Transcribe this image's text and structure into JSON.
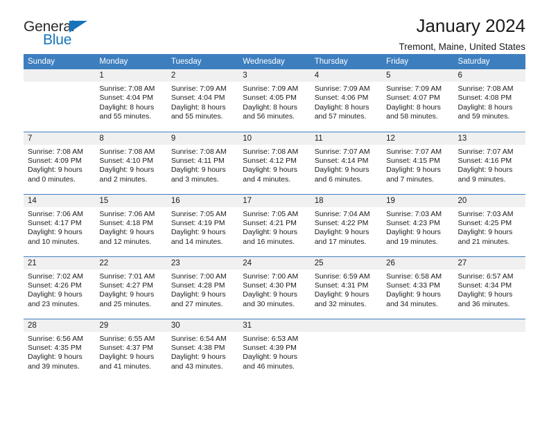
{
  "brand": {
    "name_top": "General",
    "name_bottom": "Blue",
    "accent_color": "#1574bb"
  },
  "header": {
    "title": "January 2024",
    "subtitle": "Tremont, Maine, United States"
  },
  "theme": {
    "header_row_bg": "#3d7ebf",
    "daynum_bg": "#f0f0f0",
    "text_color": "#1a1a1a"
  },
  "weekday_headers": [
    "Sunday",
    "Monday",
    "Tuesday",
    "Wednesday",
    "Thursday",
    "Friday",
    "Saturday"
  ],
  "weeks": [
    [
      {
        "day": "",
        "sunrise": "",
        "sunset": "",
        "daylight_line1": "",
        "daylight_line2": ""
      },
      {
        "day": "1",
        "sunrise": "Sunrise: 7:08 AM",
        "sunset": "Sunset: 4:04 PM",
        "daylight_line1": "Daylight: 8 hours",
        "daylight_line2": "and 55 minutes."
      },
      {
        "day": "2",
        "sunrise": "Sunrise: 7:09 AM",
        "sunset": "Sunset: 4:04 PM",
        "daylight_line1": "Daylight: 8 hours",
        "daylight_line2": "and 55 minutes."
      },
      {
        "day": "3",
        "sunrise": "Sunrise: 7:09 AM",
        "sunset": "Sunset: 4:05 PM",
        "daylight_line1": "Daylight: 8 hours",
        "daylight_line2": "and 56 minutes."
      },
      {
        "day": "4",
        "sunrise": "Sunrise: 7:09 AM",
        "sunset": "Sunset: 4:06 PM",
        "daylight_line1": "Daylight: 8 hours",
        "daylight_line2": "and 57 minutes."
      },
      {
        "day": "5",
        "sunrise": "Sunrise: 7:09 AM",
        "sunset": "Sunset: 4:07 PM",
        "daylight_line1": "Daylight: 8 hours",
        "daylight_line2": "and 58 minutes."
      },
      {
        "day": "6",
        "sunrise": "Sunrise: 7:08 AM",
        "sunset": "Sunset: 4:08 PM",
        "daylight_line1": "Daylight: 8 hours",
        "daylight_line2": "and 59 minutes."
      }
    ],
    [
      {
        "day": "7",
        "sunrise": "Sunrise: 7:08 AM",
        "sunset": "Sunset: 4:09 PM",
        "daylight_line1": "Daylight: 9 hours",
        "daylight_line2": "and 0 minutes."
      },
      {
        "day": "8",
        "sunrise": "Sunrise: 7:08 AM",
        "sunset": "Sunset: 4:10 PM",
        "daylight_line1": "Daylight: 9 hours",
        "daylight_line2": "and 2 minutes."
      },
      {
        "day": "9",
        "sunrise": "Sunrise: 7:08 AM",
        "sunset": "Sunset: 4:11 PM",
        "daylight_line1": "Daylight: 9 hours",
        "daylight_line2": "and 3 minutes."
      },
      {
        "day": "10",
        "sunrise": "Sunrise: 7:08 AM",
        "sunset": "Sunset: 4:12 PM",
        "daylight_line1": "Daylight: 9 hours",
        "daylight_line2": "and 4 minutes."
      },
      {
        "day": "11",
        "sunrise": "Sunrise: 7:07 AM",
        "sunset": "Sunset: 4:14 PM",
        "daylight_line1": "Daylight: 9 hours",
        "daylight_line2": "and 6 minutes."
      },
      {
        "day": "12",
        "sunrise": "Sunrise: 7:07 AM",
        "sunset": "Sunset: 4:15 PM",
        "daylight_line1": "Daylight: 9 hours",
        "daylight_line2": "and 7 minutes."
      },
      {
        "day": "13",
        "sunrise": "Sunrise: 7:07 AM",
        "sunset": "Sunset: 4:16 PM",
        "daylight_line1": "Daylight: 9 hours",
        "daylight_line2": "and 9 minutes."
      }
    ],
    [
      {
        "day": "14",
        "sunrise": "Sunrise: 7:06 AM",
        "sunset": "Sunset: 4:17 PM",
        "daylight_line1": "Daylight: 9 hours",
        "daylight_line2": "and 10 minutes."
      },
      {
        "day": "15",
        "sunrise": "Sunrise: 7:06 AM",
        "sunset": "Sunset: 4:18 PM",
        "daylight_line1": "Daylight: 9 hours",
        "daylight_line2": "and 12 minutes."
      },
      {
        "day": "16",
        "sunrise": "Sunrise: 7:05 AM",
        "sunset": "Sunset: 4:19 PM",
        "daylight_line1": "Daylight: 9 hours",
        "daylight_line2": "and 14 minutes."
      },
      {
        "day": "17",
        "sunrise": "Sunrise: 7:05 AM",
        "sunset": "Sunset: 4:21 PM",
        "daylight_line1": "Daylight: 9 hours",
        "daylight_line2": "and 16 minutes."
      },
      {
        "day": "18",
        "sunrise": "Sunrise: 7:04 AM",
        "sunset": "Sunset: 4:22 PM",
        "daylight_line1": "Daylight: 9 hours",
        "daylight_line2": "and 17 minutes."
      },
      {
        "day": "19",
        "sunrise": "Sunrise: 7:03 AM",
        "sunset": "Sunset: 4:23 PM",
        "daylight_line1": "Daylight: 9 hours",
        "daylight_line2": "and 19 minutes."
      },
      {
        "day": "20",
        "sunrise": "Sunrise: 7:03 AM",
        "sunset": "Sunset: 4:25 PM",
        "daylight_line1": "Daylight: 9 hours",
        "daylight_line2": "and 21 minutes."
      }
    ],
    [
      {
        "day": "21",
        "sunrise": "Sunrise: 7:02 AM",
        "sunset": "Sunset: 4:26 PM",
        "daylight_line1": "Daylight: 9 hours",
        "daylight_line2": "and 23 minutes."
      },
      {
        "day": "22",
        "sunrise": "Sunrise: 7:01 AM",
        "sunset": "Sunset: 4:27 PM",
        "daylight_line1": "Daylight: 9 hours",
        "daylight_line2": "and 25 minutes."
      },
      {
        "day": "23",
        "sunrise": "Sunrise: 7:00 AM",
        "sunset": "Sunset: 4:28 PM",
        "daylight_line1": "Daylight: 9 hours",
        "daylight_line2": "and 27 minutes."
      },
      {
        "day": "24",
        "sunrise": "Sunrise: 7:00 AM",
        "sunset": "Sunset: 4:30 PM",
        "daylight_line1": "Daylight: 9 hours",
        "daylight_line2": "and 30 minutes."
      },
      {
        "day": "25",
        "sunrise": "Sunrise: 6:59 AM",
        "sunset": "Sunset: 4:31 PM",
        "daylight_line1": "Daylight: 9 hours",
        "daylight_line2": "and 32 minutes."
      },
      {
        "day": "26",
        "sunrise": "Sunrise: 6:58 AM",
        "sunset": "Sunset: 4:33 PM",
        "daylight_line1": "Daylight: 9 hours",
        "daylight_line2": "and 34 minutes."
      },
      {
        "day": "27",
        "sunrise": "Sunrise: 6:57 AM",
        "sunset": "Sunset: 4:34 PM",
        "daylight_line1": "Daylight: 9 hours",
        "daylight_line2": "and 36 minutes."
      }
    ],
    [
      {
        "day": "28",
        "sunrise": "Sunrise: 6:56 AM",
        "sunset": "Sunset: 4:35 PM",
        "daylight_line1": "Daylight: 9 hours",
        "daylight_line2": "and 39 minutes."
      },
      {
        "day": "29",
        "sunrise": "Sunrise: 6:55 AM",
        "sunset": "Sunset: 4:37 PM",
        "daylight_line1": "Daylight: 9 hours",
        "daylight_line2": "and 41 minutes."
      },
      {
        "day": "30",
        "sunrise": "Sunrise: 6:54 AM",
        "sunset": "Sunset: 4:38 PM",
        "daylight_line1": "Daylight: 9 hours",
        "daylight_line2": "and 43 minutes."
      },
      {
        "day": "31",
        "sunrise": "Sunrise: 6:53 AM",
        "sunset": "Sunset: 4:39 PM",
        "daylight_line1": "Daylight: 9 hours",
        "daylight_line2": "and 46 minutes."
      },
      {
        "day": "",
        "sunrise": "",
        "sunset": "",
        "daylight_line1": "",
        "daylight_line2": ""
      },
      {
        "day": "",
        "sunrise": "",
        "sunset": "",
        "daylight_line1": "",
        "daylight_line2": ""
      },
      {
        "day": "",
        "sunrise": "",
        "sunset": "",
        "daylight_line1": "",
        "daylight_line2": ""
      }
    ]
  ]
}
